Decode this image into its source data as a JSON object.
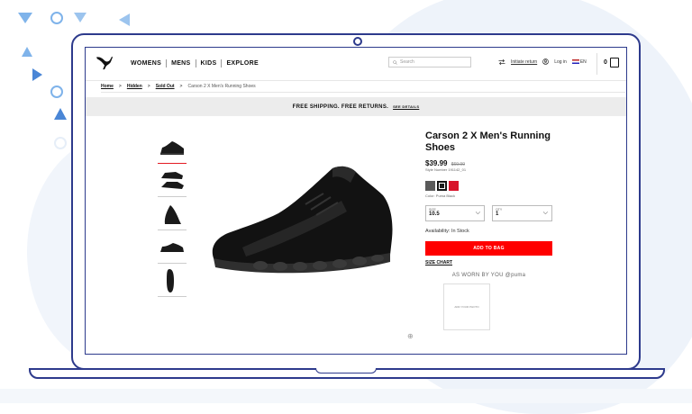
{
  "header": {
    "nav": [
      "WOMENS",
      "MENS",
      "KIDS",
      "EXPLORE"
    ],
    "search_placeholder": "Search",
    "initiate_return": "Initiate return",
    "login": "Log in",
    "locale": "EN",
    "cart_count": "0"
  },
  "breadcrumb": {
    "items": [
      "Home",
      "Hidden",
      "Sold Out"
    ],
    "current": "Carson 2 X Men's Running Shoes"
  },
  "promo": {
    "text": "FREE SHIPPING. FREE RETURNS.",
    "details": "SEE DETAILS"
  },
  "product": {
    "title": "Carson 2 X Men's Running Shoes",
    "price": "$39.99",
    "old_price": "$69.99",
    "style_number": "Style Number 191142_01",
    "swatch_colors": [
      "#5a5a5a",
      "#1b1b1b",
      "#d8142a"
    ],
    "color_label": "Color: Puma Black",
    "size_label": "SIZE",
    "size_value": "10.5",
    "qty_label": "QTY",
    "qty_value": "1",
    "availability": "Availability:  In Stock",
    "add_to_bag": "ADD TO BAG",
    "size_chart": "SIZE CHART",
    "worn_by": "AS WORN BY YOU @puma",
    "ugc_text": "ADD YOUR PHOTO"
  },
  "colors": {
    "accent": "#ff0000",
    "device_outline": "#2d3a8c"
  }
}
